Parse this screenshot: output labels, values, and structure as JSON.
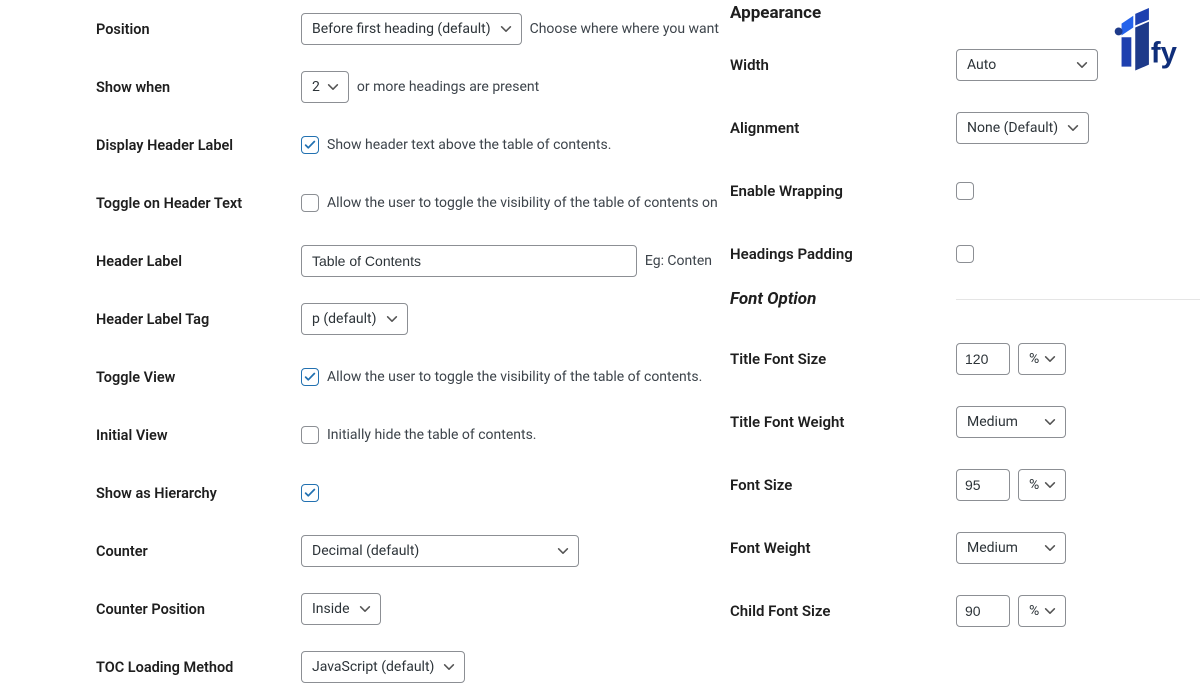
{
  "logo_text": "iTify",
  "left": {
    "position": {
      "label": "Position",
      "value": "Before first heading (default)",
      "help": "Choose where where you want"
    },
    "show_when": {
      "label": "Show when",
      "value": "2",
      "help": "or more headings are present"
    },
    "display_header_label": {
      "label": "Display Header Label",
      "checked": true,
      "help": "Show header text above the table of contents."
    },
    "toggle_on_header_text": {
      "label": "Toggle on Header Text",
      "checked": false,
      "help": "Allow the user to toggle the visibility of the table of contents on"
    },
    "header_label": {
      "label": "Header Label",
      "value": "Table of Contents",
      "help": "Eg: Conten"
    },
    "header_label_tag": {
      "label": "Header Label Tag",
      "value": "p (default)"
    },
    "toggle_view": {
      "label": "Toggle View",
      "checked": true,
      "help": "Allow the user to toggle the visibility of the table of contents."
    },
    "initial_view": {
      "label": "Initial View",
      "checked": false,
      "help": "Initially hide the table of contents."
    },
    "show_as_hierarchy": {
      "label": "Show as Hierarchy",
      "checked": true
    },
    "counter": {
      "label": "Counter",
      "value": "Decimal (default)"
    },
    "counter_position": {
      "label": "Counter Position",
      "value": "Inside"
    },
    "toc_loading_method": {
      "label": "TOC Loading Method",
      "value": "JavaScript (default)"
    }
  },
  "right": {
    "appearance_heading": "Appearance",
    "width": {
      "label": "Width",
      "value": "Auto"
    },
    "alignment": {
      "label": "Alignment",
      "value": "None (Default)"
    },
    "enable_wrapping": {
      "label": "Enable Wrapping",
      "checked": false
    },
    "headings_padding": {
      "label": "Headings Padding",
      "checked": false
    },
    "font_option_heading": "Font Option",
    "title_font_size": {
      "label": "Title Font Size",
      "value": "120",
      "unit": "%"
    },
    "title_font_weight": {
      "label": "Title Font Weight",
      "value": "Medium"
    },
    "font_size": {
      "label": "Font Size",
      "value": "95",
      "unit": "%"
    },
    "font_weight": {
      "label": "Font Weight",
      "value": "Medium"
    },
    "child_font_size": {
      "label": "Child Font Size",
      "value": "90",
      "unit": "%"
    }
  }
}
